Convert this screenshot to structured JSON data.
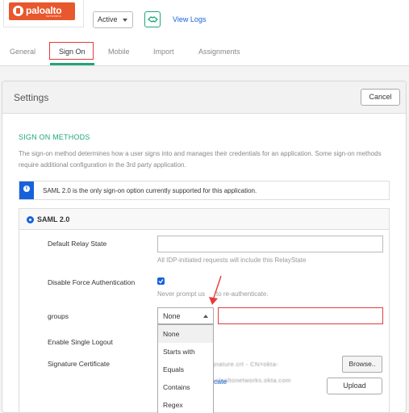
{
  "header": {
    "logo": {
      "brand": "paloalto",
      "sub": "NETWORKS"
    },
    "status": "Active",
    "view_logs": "View Logs"
  },
  "tabs": [
    {
      "label": "General"
    },
    {
      "label": "Sign On",
      "active": true
    },
    {
      "label": "Mobile"
    },
    {
      "label": "Import"
    },
    {
      "label": "Assignments"
    }
  ],
  "settings": {
    "title": "Settings",
    "cancel": "Cancel",
    "section_title": "SIGN ON METHODS",
    "section_desc": "The sign-on method determines how a user signs into and manages their credentials for an application. Some sign-on methods require additional configuration in the 3rd party application.",
    "info": "SAML 2.0 is the only sign-on option currently supported for this application."
  },
  "saml": {
    "label": "SAML 2.0",
    "relay_state": {
      "label": "Default Relay State",
      "value": "",
      "hint": "All IDP-initiated requests will include this RelayState"
    },
    "force_auth": {
      "label": "Disable Force Authentication",
      "checked": true,
      "hint_a": "Never prompt us",
      "hint_b": "to re-authenticate."
    },
    "groups": {
      "label": "groups",
      "selected": "None",
      "value": "",
      "options": [
        "None",
        "Starts with",
        "Equals",
        "Contains",
        "Regex"
      ]
    },
    "single_logout": {
      "label": "Enable Single Logout"
    },
    "signature_cert": {
      "label": "Signature Certificate",
      "file_name": "gnature.crt - CN=okta-paloaltonetworks.okta.com",
      "browse": "Browse..",
      "upload": "Upload",
      "link_fragment": "cate"
    }
  },
  "colors": {
    "accent_green": "#1fa67a",
    "link_blue": "#1662dd",
    "highlight_red": "#e43b3b",
    "brand_orange": "#e8572d"
  }
}
